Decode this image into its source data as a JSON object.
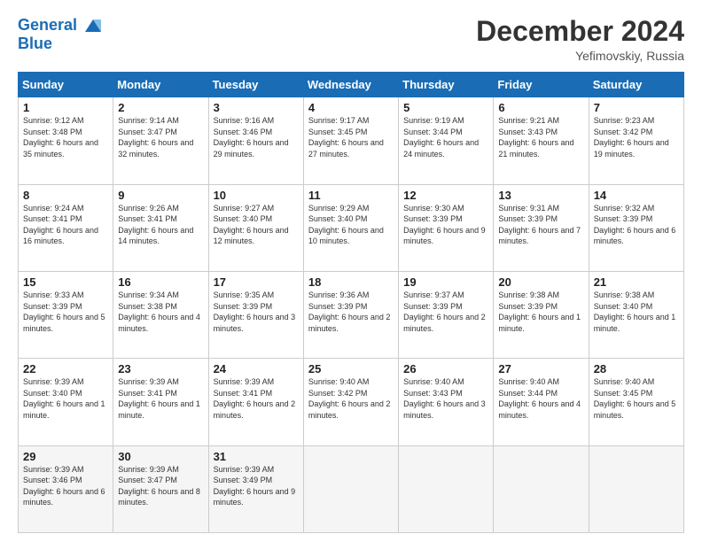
{
  "logo": {
    "line1": "General",
    "line2": "Blue"
  },
  "title": "December 2024",
  "location": "Yefimovskiy, Russia",
  "days_of_week": [
    "Sunday",
    "Monday",
    "Tuesday",
    "Wednesday",
    "Thursday",
    "Friday",
    "Saturday"
  ],
  "weeks": [
    [
      {
        "day": "1",
        "sunrise": "9:12 AM",
        "sunset": "3:48 PM",
        "daylight": "6 hours and 35 minutes."
      },
      {
        "day": "2",
        "sunrise": "9:14 AM",
        "sunset": "3:47 PM",
        "daylight": "6 hours and 32 minutes."
      },
      {
        "day": "3",
        "sunrise": "9:16 AM",
        "sunset": "3:46 PM",
        "daylight": "6 hours and 29 minutes."
      },
      {
        "day": "4",
        "sunrise": "9:17 AM",
        "sunset": "3:45 PM",
        "daylight": "6 hours and 27 minutes."
      },
      {
        "day": "5",
        "sunrise": "9:19 AM",
        "sunset": "3:44 PM",
        "daylight": "6 hours and 24 minutes."
      },
      {
        "day": "6",
        "sunrise": "9:21 AM",
        "sunset": "3:43 PM",
        "daylight": "6 hours and 21 minutes."
      },
      {
        "day": "7",
        "sunrise": "9:23 AM",
        "sunset": "3:42 PM",
        "daylight": "6 hours and 19 minutes."
      }
    ],
    [
      {
        "day": "8",
        "sunrise": "9:24 AM",
        "sunset": "3:41 PM",
        "daylight": "6 hours and 16 minutes."
      },
      {
        "day": "9",
        "sunrise": "9:26 AM",
        "sunset": "3:41 PM",
        "daylight": "6 hours and 14 minutes."
      },
      {
        "day": "10",
        "sunrise": "9:27 AM",
        "sunset": "3:40 PM",
        "daylight": "6 hours and 12 minutes."
      },
      {
        "day": "11",
        "sunrise": "9:29 AM",
        "sunset": "3:40 PM",
        "daylight": "6 hours and 10 minutes."
      },
      {
        "day": "12",
        "sunrise": "9:30 AM",
        "sunset": "3:39 PM",
        "daylight": "6 hours and 9 minutes."
      },
      {
        "day": "13",
        "sunrise": "9:31 AM",
        "sunset": "3:39 PM",
        "daylight": "6 hours and 7 minutes."
      },
      {
        "day": "14",
        "sunrise": "9:32 AM",
        "sunset": "3:39 PM",
        "daylight": "6 hours and 6 minutes."
      }
    ],
    [
      {
        "day": "15",
        "sunrise": "9:33 AM",
        "sunset": "3:39 PM",
        "daylight": "6 hours and 5 minutes."
      },
      {
        "day": "16",
        "sunrise": "9:34 AM",
        "sunset": "3:38 PM",
        "daylight": "6 hours and 4 minutes."
      },
      {
        "day": "17",
        "sunrise": "9:35 AM",
        "sunset": "3:39 PM",
        "daylight": "6 hours and 3 minutes."
      },
      {
        "day": "18",
        "sunrise": "9:36 AM",
        "sunset": "3:39 PM",
        "daylight": "6 hours and 2 minutes."
      },
      {
        "day": "19",
        "sunrise": "9:37 AM",
        "sunset": "3:39 PM",
        "daylight": "6 hours and 2 minutes."
      },
      {
        "day": "20",
        "sunrise": "9:38 AM",
        "sunset": "3:39 PM",
        "daylight": "6 hours and 1 minute."
      },
      {
        "day": "21",
        "sunrise": "9:38 AM",
        "sunset": "3:40 PM",
        "daylight": "6 hours and 1 minute."
      }
    ],
    [
      {
        "day": "22",
        "sunrise": "9:39 AM",
        "sunset": "3:40 PM",
        "daylight": "6 hours and 1 minute."
      },
      {
        "day": "23",
        "sunrise": "9:39 AM",
        "sunset": "3:41 PM",
        "daylight": "6 hours and 1 minute."
      },
      {
        "day": "24",
        "sunrise": "9:39 AM",
        "sunset": "3:41 PM",
        "daylight": "6 hours and 2 minutes."
      },
      {
        "day": "25",
        "sunrise": "9:40 AM",
        "sunset": "3:42 PM",
        "daylight": "6 hours and 2 minutes."
      },
      {
        "day": "26",
        "sunrise": "9:40 AM",
        "sunset": "3:43 PM",
        "daylight": "6 hours and 3 minutes."
      },
      {
        "day": "27",
        "sunrise": "9:40 AM",
        "sunset": "3:44 PM",
        "daylight": "6 hours and 4 minutes."
      },
      {
        "day": "28",
        "sunrise": "9:40 AM",
        "sunset": "3:45 PM",
        "daylight": "6 hours and 5 minutes."
      }
    ],
    [
      {
        "day": "29",
        "sunrise": "9:39 AM",
        "sunset": "3:46 PM",
        "daylight": "6 hours and 6 minutes."
      },
      {
        "day": "30",
        "sunrise": "9:39 AM",
        "sunset": "3:47 PM",
        "daylight": "6 hours and 8 minutes."
      },
      {
        "day": "31",
        "sunrise": "9:39 AM",
        "sunset": "3:49 PM",
        "daylight": "6 hours and 9 minutes."
      },
      null,
      null,
      null,
      null
    ]
  ]
}
